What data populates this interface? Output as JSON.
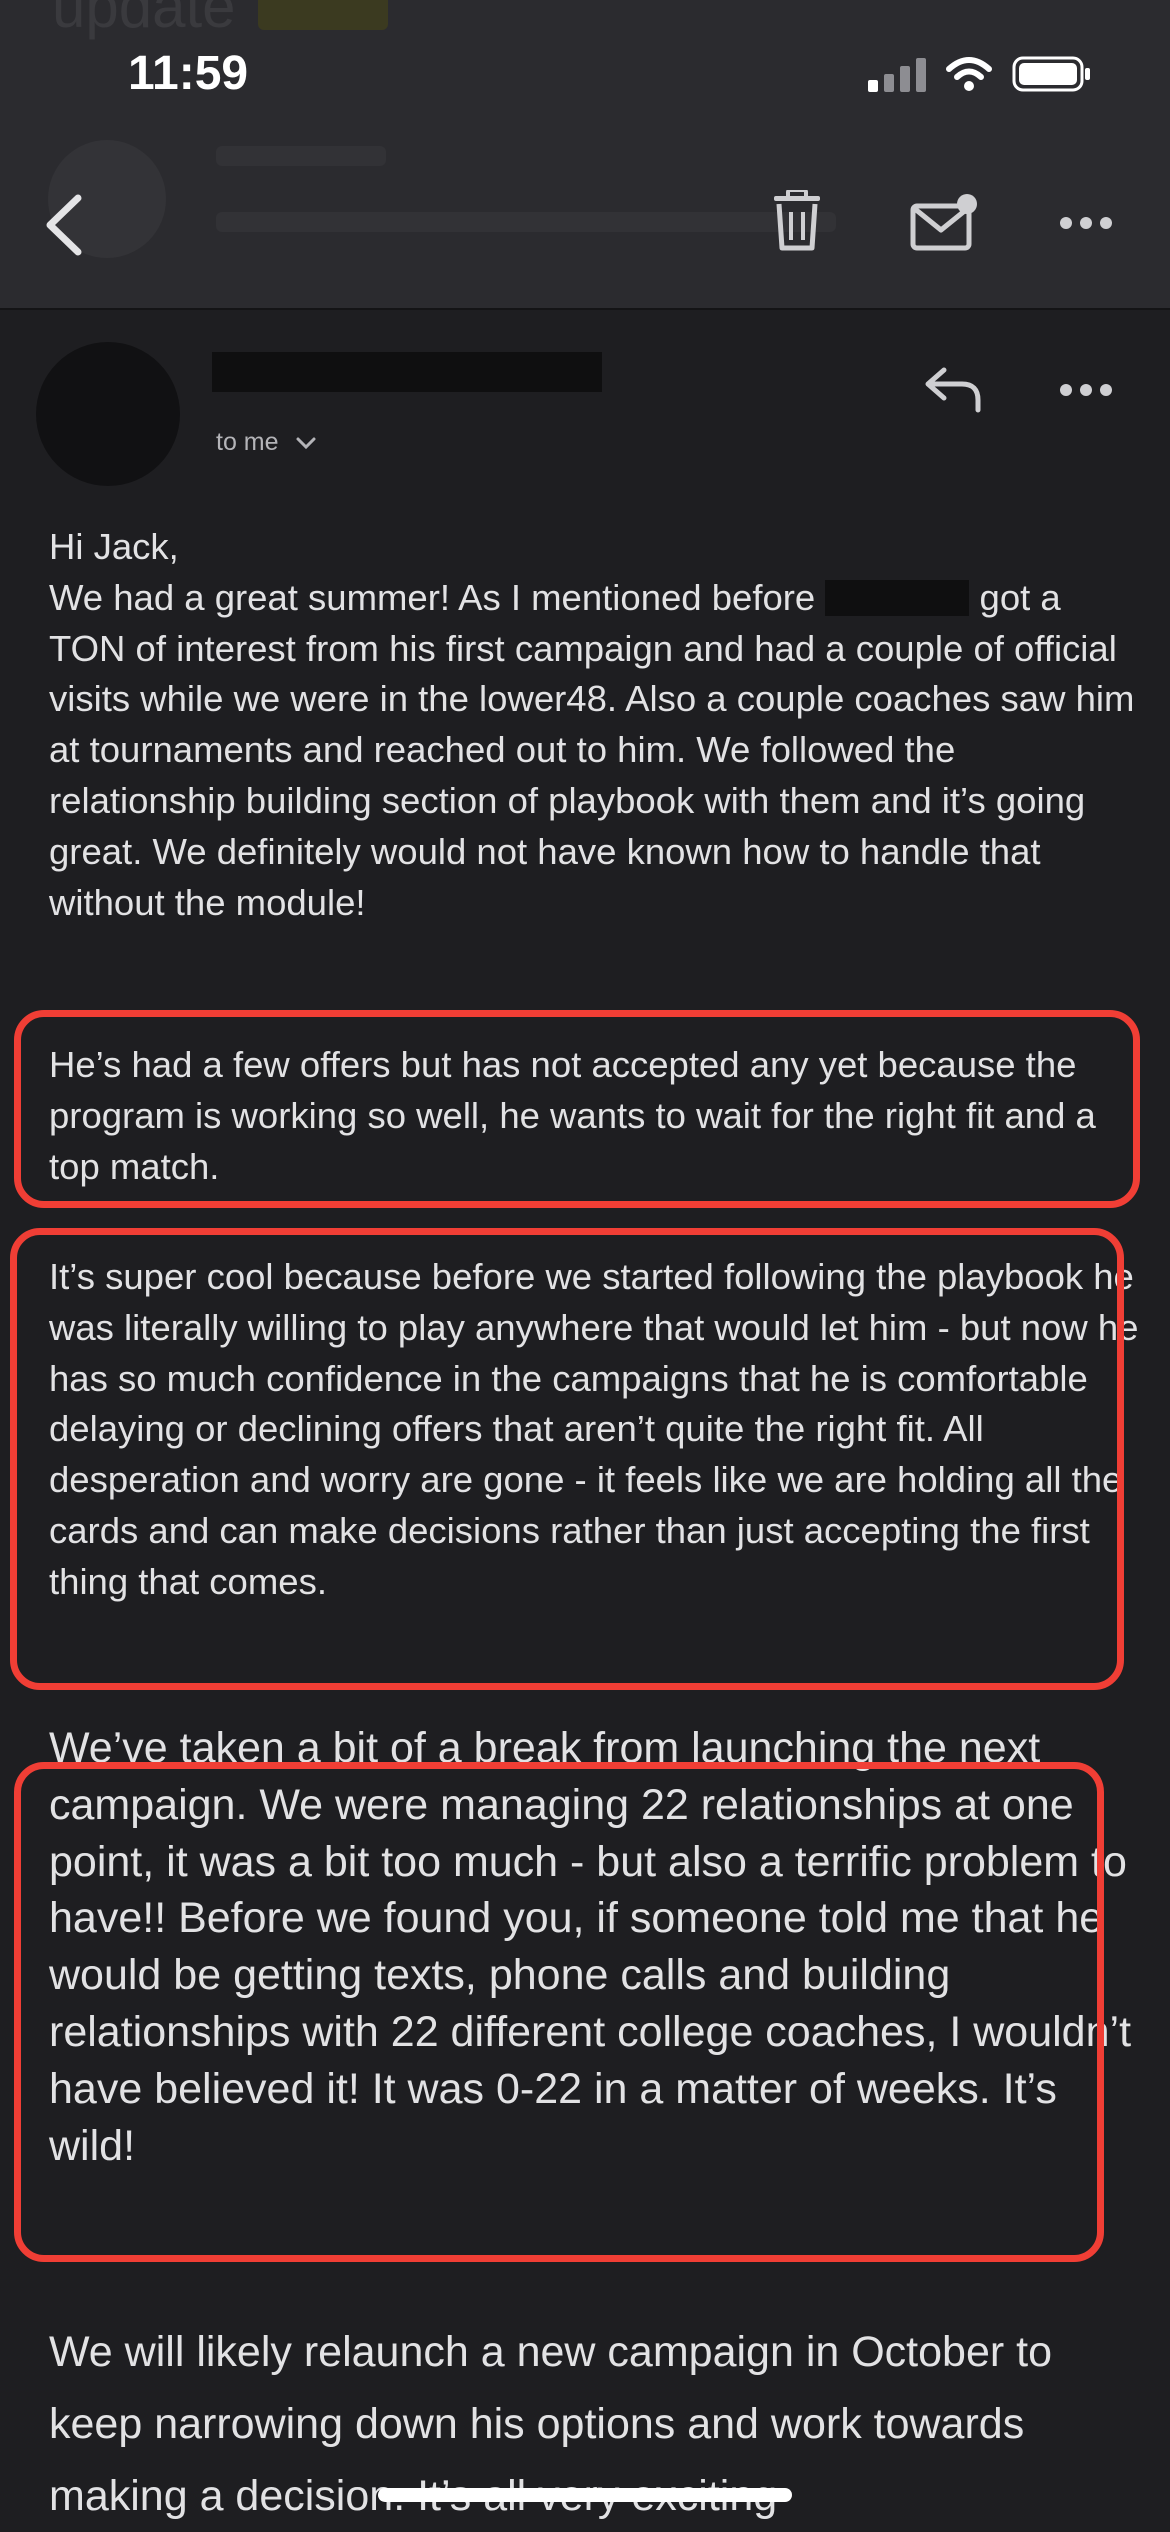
{
  "status_bar": {
    "time": "11:59"
  },
  "header": {
    "ghost_title": "update"
  },
  "actions": {
    "back": "back-arrow-icon",
    "delete": "trash-icon",
    "mark_unread": "mail-unread-icon",
    "more": "more-dots-icon"
  },
  "message": {
    "to_label": "to me",
    "greeting": "Hi Jack,",
    "p1_before_redaction": "We had a great summer! As I mentioned before ",
    "p1_after_redaction": " got a TON of interest from his first campaign and had a couple of official visits while we were in the lower48. Also a couple coaches saw him at tournaments and reached out to him. We followed the relationship building section of playbook with them and it’s going great. We definitely would not have known how to handle that without the module!",
    "p2": "He’s had a few offers but has not accepted any yet because the program is working so well, he wants to wait for the right fit and a top match.",
    "p3": "It’s super cool because before we started following the playbook he was literally willing to play anywhere that would let him - but now he has so much confidence in the campaigns that he is comfortable delaying or declining offers that aren’t quite the right fit. All desperation and worry are gone - it feels like we are holding all the cards and can make decisions rather than just accepting the first thing that comes.",
    "p4": "We’ve taken a bit of a break from launching the next campaign. We were managing 22 relationships at one point, it was a bit too much - but also a terrific problem to have!! Before we found you, if someone told me that he would be getting texts, phone calls and building relationships with 22 different college coaches, I wouldn’t have believed it! It was 0-22 in a matter of weeks. It’s wild!",
    "p5": "We will likely relaunch a new campaign in October to keep narrowing down his options and work towards making a decision. It’s all very exciting"
  },
  "colors": {
    "background": "#1e1e21",
    "header": "#2b2b2f",
    "highlight": "#f03e35",
    "text": "#e2e2e4"
  }
}
